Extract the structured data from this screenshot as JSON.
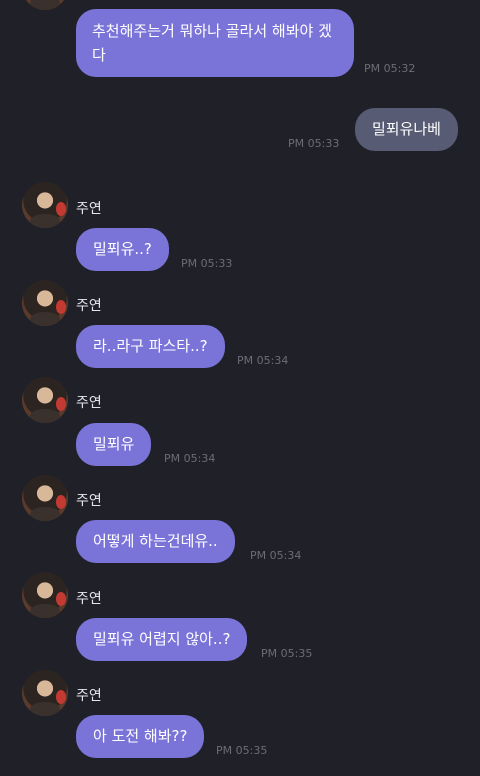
{
  "messages": [
    {
      "sender": "",
      "text": "추천해주는거 뭐하나 골라서 해봐야 겠다",
      "time": "PM 05:32"
    },
    {
      "sender": "me",
      "text": "밀푀유나베",
      "time": "PM 05:33"
    },
    {
      "sender": "주연",
      "text": "밀푀유..?",
      "time": "PM 05:33"
    },
    {
      "sender": "주연",
      "text": "라..라구 파스타..?",
      "time": "PM 05:34"
    },
    {
      "sender": "주연",
      "text": "밀푀유",
      "time": "PM 05:34"
    },
    {
      "sender": "주연",
      "text": "어떻게 하는건데유..",
      "time": "PM 05:34"
    },
    {
      "sender": "주연",
      "text": "밀푀유 어렵지 않아..?",
      "time": "PM 05:35"
    },
    {
      "sender": "주연",
      "text": "아 도전 해봐??",
      "time": "PM 05:35"
    }
  ],
  "colors": {
    "background": "#202028",
    "incoming_bubble": "#7b74d8",
    "outgoing_bubble": "#575b73"
  },
  "icons": {
    "avatar": "profile-photo"
  }
}
